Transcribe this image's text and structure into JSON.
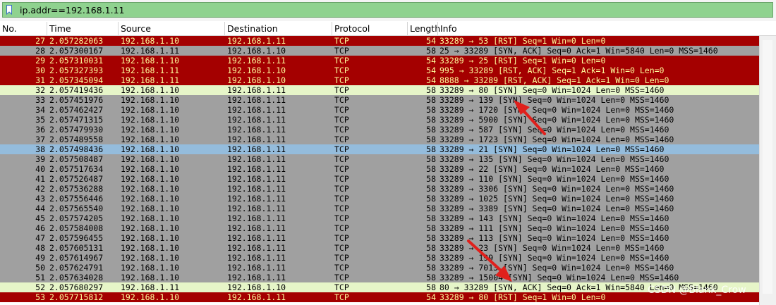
{
  "filter": {
    "value": "ip.addr==192.168.1.11"
  },
  "columns": [
    {
      "key": "no",
      "label": "No."
    },
    {
      "key": "time",
      "label": "Time"
    },
    {
      "key": "source",
      "label": "Source"
    },
    {
      "key": "destination",
      "label": "Destination"
    },
    {
      "key": "protocol",
      "label": "Protocol"
    },
    {
      "key": "length",
      "label": "Length"
    },
    {
      "key": "info",
      "label": "Info"
    }
  ],
  "colors": {
    "rst_bg": "#a40000",
    "rst_fg": "#fffc9c",
    "gray_bg": "#a0a0a0",
    "gray_fg": "#000000",
    "syn_bg": "#e6f5c8",
    "selected_bg": "#94bcdc",
    "arrow": "#e0201c"
  },
  "packets": [
    {
      "no": "27",
      "time": "2.057282063",
      "source": "192.168.1.10",
      "destination": "192.168.1.11",
      "protocol": "TCP",
      "length": "54",
      "info": "33289 → 53 [RST] Seq=1 Win=0 Len=0",
      "style": "rst"
    },
    {
      "no": "28",
      "time": "2.057300167",
      "source": "192.168.1.11",
      "destination": "192.168.1.10",
      "protocol": "TCP",
      "length": "58",
      "info": "25 → 33289 [SYN, ACK] Seq=0 Ack=1 Win=5840 Len=0 MSS=1460",
      "style": "gray"
    },
    {
      "no": "29",
      "time": "2.057310031",
      "source": "192.168.1.10",
      "destination": "192.168.1.11",
      "protocol": "TCP",
      "length": "54",
      "info": "33289 → 25 [RST] Seq=1 Win=0 Len=0",
      "style": "rst"
    },
    {
      "no": "30",
      "time": "2.057327393",
      "source": "192.168.1.11",
      "destination": "192.168.1.10",
      "protocol": "TCP",
      "length": "54",
      "info": "995 → 33289 [RST, ACK] Seq=1 Ack=1 Win=0 Len=0",
      "style": "rst"
    },
    {
      "no": "31",
      "time": "2.057345094",
      "source": "192.168.1.11",
      "destination": "192.168.1.10",
      "protocol": "TCP",
      "length": "54",
      "info": "8888 → 33289 [RST, ACK] Seq=1 Ack=1 Win=0 Len=0",
      "style": "rst"
    },
    {
      "no": "32",
      "time": "2.057419436",
      "source": "192.168.1.10",
      "destination": "192.168.1.11",
      "protocol": "TCP",
      "length": "58",
      "info": "33289 → 80 [SYN] Seq=0 Win=1024 Len=0 MSS=1460",
      "style": "syn"
    },
    {
      "no": "33",
      "time": "2.057451976",
      "source": "192.168.1.10",
      "destination": "192.168.1.11",
      "protocol": "TCP",
      "length": "58",
      "info": "33289 → 139 [SYN] Seq=0 Win=1024 Len=0 MSS=1460",
      "style": "gray"
    },
    {
      "no": "34",
      "time": "2.057462427",
      "source": "192.168.1.10",
      "destination": "192.168.1.11",
      "protocol": "TCP",
      "length": "58",
      "info": "33289 → 1720 [SYN] Seq=0 Win=1024 Len=0 MSS=1460",
      "style": "gray"
    },
    {
      "no": "35",
      "time": "2.057471315",
      "source": "192.168.1.10",
      "destination": "192.168.1.11",
      "protocol": "TCP",
      "length": "58",
      "info": "33289 → 5900 [SYN] Seq=0 Win=1024 Len=0 MSS=1460",
      "style": "gray"
    },
    {
      "no": "36",
      "time": "2.057479930",
      "source": "192.168.1.10",
      "destination": "192.168.1.11",
      "protocol": "TCP",
      "length": "58",
      "info": "33289 → 587 [SYN] Seq=0 Win=1024 Len=0 MSS=1460",
      "style": "gray"
    },
    {
      "no": "37",
      "time": "2.057489558",
      "source": "192.168.1.10",
      "destination": "192.168.1.11",
      "protocol": "TCP",
      "length": "58",
      "info": "33289 → 1723 [SYN] Seq=0 Win=1024 Len=0 MSS=1460",
      "style": "gray"
    },
    {
      "no": "38",
      "time": "2.057498436",
      "source": "192.168.1.10",
      "destination": "192.168.1.11",
      "protocol": "TCP",
      "length": "58",
      "info": "33289 → 21 [SYN] Seq=0 Win=1024 Len=0 MSS=1460",
      "style": "selected"
    },
    {
      "no": "39",
      "time": "2.057508487",
      "source": "192.168.1.10",
      "destination": "192.168.1.11",
      "protocol": "TCP",
      "length": "58",
      "info": "33289 → 135 [SYN] Seq=0 Win=1024 Len=0 MSS=1460",
      "style": "gray"
    },
    {
      "no": "40",
      "time": "2.057517634",
      "source": "192.168.1.10",
      "destination": "192.168.1.11",
      "protocol": "TCP",
      "length": "58",
      "info": "33289 → 22 [SYN] Seq=0 Win=1024 Len=0 MSS=1460",
      "style": "gray"
    },
    {
      "no": "41",
      "time": "2.057526487",
      "source": "192.168.1.10",
      "destination": "192.168.1.11",
      "protocol": "TCP",
      "length": "58",
      "info": "33289 → 110 [SYN] Seq=0 Win=1024 Len=0 MSS=1460",
      "style": "gray"
    },
    {
      "no": "42",
      "time": "2.057536288",
      "source": "192.168.1.10",
      "destination": "192.168.1.11",
      "protocol": "TCP",
      "length": "58",
      "info": "33289 → 3306 [SYN] Seq=0 Win=1024 Len=0 MSS=1460",
      "style": "gray"
    },
    {
      "no": "43",
      "time": "2.057556446",
      "source": "192.168.1.10",
      "destination": "192.168.1.11",
      "protocol": "TCP",
      "length": "58",
      "info": "33289 → 1025 [SYN] Seq=0 Win=1024 Len=0 MSS=1460",
      "style": "gray"
    },
    {
      "no": "44",
      "time": "2.057565540",
      "source": "192.168.1.10",
      "destination": "192.168.1.11",
      "protocol": "TCP",
      "length": "58",
      "info": "33289 → 3389 [SYN] Seq=0 Win=1024 Len=0 MSS=1460",
      "style": "gray"
    },
    {
      "no": "45",
      "time": "2.057574205",
      "source": "192.168.1.10",
      "destination": "192.168.1.11",
      "protocol": "TCP",
      "length": "58",
      "info": "33289 → 143 [SYN] Seq=0 Win=1024 Len=0 MSS=1460",
      "style": "gray"
    },
    {
      "no": "46",
      "time": "2.057584008",
      "source": "192.168.1.10",
      "destination": "192.168.1.11",
      "protocol": "TCP",
      "length": "58",
      "info": "33289 → 111 [SYN] Seq=0 Win=1024 Len=0 MSS=1460",
      "style": "gray"
    },
    {
      "no": "47",
      "time": "2.057596455",
      "source": "192.168.1.10",
      "destination": "192.168.1.11",
      "protocol": "TCP",
      "length": "58",
      "info": "33289 → 113 [SYN] Seq=0 Win=1024 Len=0 MSS=1460",
      "style": "gray"
    },
    {
      "no": "48",
      "time": "2.057605131",
      "source": "192.168.1.10",
      "destination": "192.168.1.11",
      "protocol": "TCP",
      "length": "58",
      "info": "33289 → 23 [SYN] Seq=0 Win=1024 Len=0 MSS=1460",
      "style": "gray"
    },
    {
      "no": "49",
      "time": "2.057614967",
      "source": "192.168.1.10",
      "destination": "192.168.1.11",
      "protocol": "TCP",
      "length": "58",
      "info": "33289 → 199 [SYN] Seq=0 Win=1024 Len=0 MSS=1460",
      "style": "gray"
    },
    {
      "no": "50",
      "time": "2.057624791",
      "source": "192.168.1.10",
      "destination": "192.168.1.11",
      "protocol": "TCP",
      "length": "58",
      "info": "33289 → 7013 [SYN] Seq=0 Win=1024 Len=0 MSS=1460",
      "style": "gray"
    },
    {
      "no": "51",
      "time": "2.057634028",
      "source": "192.168.1.10",
      "destination": "192.168.1.11",
      "protocol": "TCP",
      "length": "58",
      "info": "33289 → 15004 [SYN] Seq=0 Win=1024 Len=0 MSS=1460",
      "style": "gray"
    },
    {
      "no": "52",
      "time": "2.057680297",
      "source": "192.168.1.11",
      "destination": "192.168.1.10",
      "protocol": "TCP",
      "length": "58",
      "info": "80 → 33289 [SYN, ACK] Seq=0 Ack=1 Win=5840 Len=0 MSS=1460",
      "style": "syn"
    },
    {
      "no": "53",
      "time": "2.057715812",
      "source": "192.168.1.10",
      "destination": "192.168.1.11",
      "protocol": "TCP",
      "length": "54",
      "info": "33289 → 80 [RST] Seq=1 Win=0 Len=0",
      "style": "rst"
    }
  ],
  "watermark": "CSDN @Blank_Crow"
}
